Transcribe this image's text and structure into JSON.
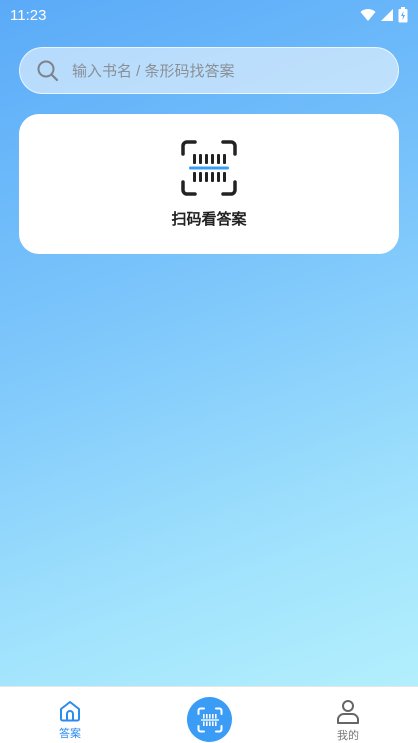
{
  "status_bar": {
    "time": "11:23"
  },
  "search": {
    "placeholder": "输入书名 / 条形码找答案"
  },
  "scan_card": {
    "label": "扫码看答案"
  },
  "tab_bar": {
    "answers_label": "答案",
    "mine_label": "我的"
  },
  "colors": {
    "accent": "#3a9cf5",
    "active_tab": "#2b8cf0",
    "inactive_tab": "#777777"
  },
  "icons": [
    "wifi-icon",
    "signal-icon",
    "battery-icon",
    "search-icon",
    "barcode-scan-icon",
    "home-icon",
    "scan-icon",
    "user-icon"
  ]
}
